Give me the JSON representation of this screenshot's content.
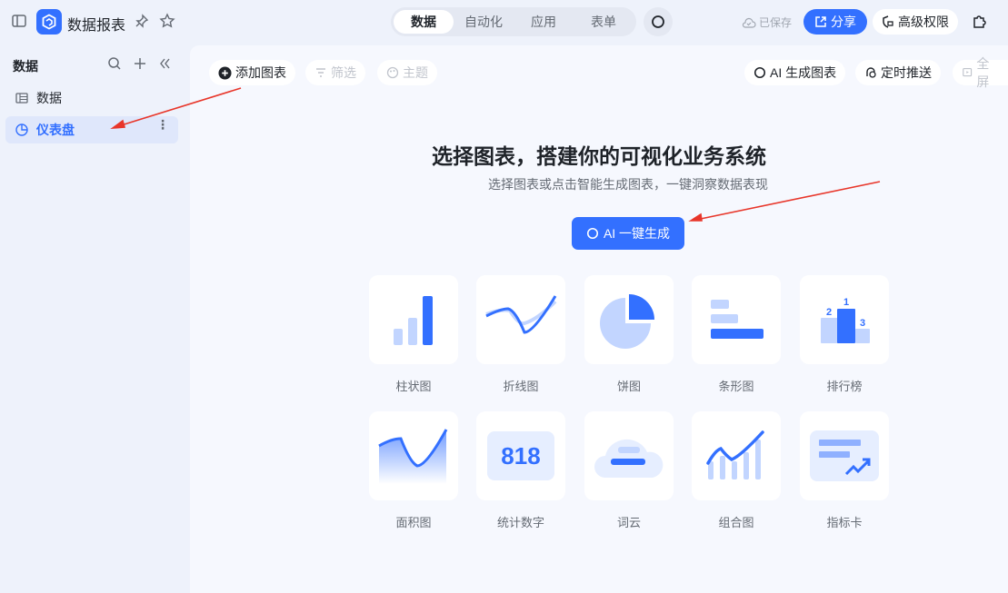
{
  "header": {
    "app_title": "数据报表",
    "tabs": [
      {
        "label": "数据"
      },
      {
        "label": "自动化"
      },
      {
        "label": "应用"
      },
      {
        "label": "表单"
      }
    ],
    "saved_status": "已保存",
    "share_label": "分享",
    "permissions_label": "高级权限"
  },
  "sidebar": {
    "heading": "数据",
    "items": [
      {
        "label": "数据"
      },
      {
        "label": "仪表盘"
      }
    ]
  },
  "toolbar": {
    "add_chart": "添加图表",
    "filter": "筛选",
    "theme": "主题",
    "ai_chart": "AI 生成图表",
    "scheduled_push": "定时推送",
    "fullscreen": "全屏"
  },
  "main": {
    "headline": "选择图表，搭建你的可视化业务系统",
    "subtitle": "选择图表或点击智能生成图表，一键洞察数据表现",
    "ai_button": "AI 一键生成",
    "chart_types": [
      {
        "label": "柱状图"
      },
      {
        "label": "折线图"
      },
      {
        "label": "饼图"
      },
      {
        "label": "条形图"
      },
      {
        "label": "排行榜",
        "ranks": [
          "1",
          "2",
          "3"
        ]
      },
      {
        "label": "面积图"
      },
      {
        "label": "统计数字",
        "value": "818"
      },
      {
        "label": "词云"
      },
      {
        "label": "组合图"
      },
      {
        "label": "指标卡"
      }
    ]
  },
  "colors": {
    "accent": "#3370ff",
    "light": "#c2d5ff",
    "arrow": "#e8362a"
  }
}
